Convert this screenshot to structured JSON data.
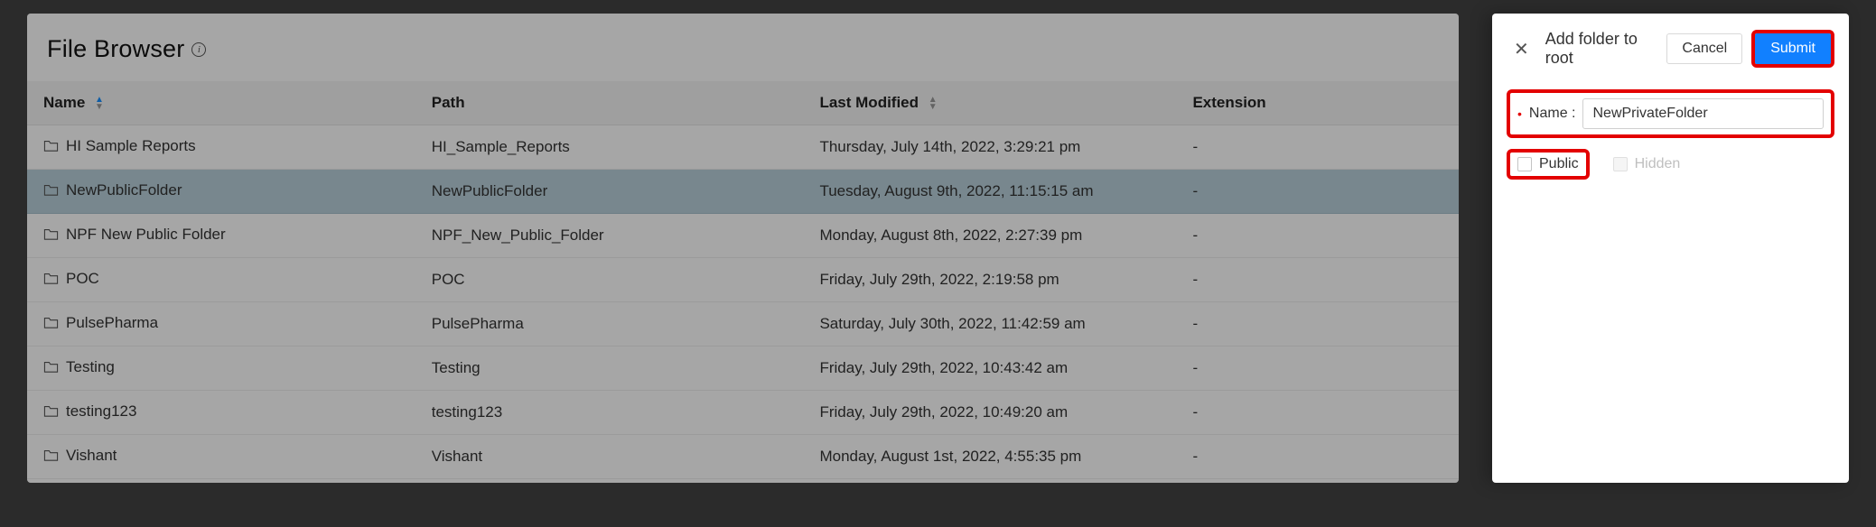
{
  "page": {
    "title": "File Browser"
  },
  "table": {
    "headers": {
      "name": "Name",
      "path": "Path",
      "last_modified": "Last Modified",
      "extension": "Extension"
    },
    "rows": [
      {
        "name": "HI Sample Reports",
        "path": "HI_Sample_Reports",
        "last_modified": "Thursday, July 14th, 2022, 3:29:21 pm",
        "extension": "-",
        "selected": false
      },
      {
        "name": "NewPublicFolder",
        "path": "NewPublicFolder",
        "last_modified": "Tuesday, August 9th, 2022, 11:15:15 am",
        "extension": "-",
        "selected": true
      },
      {
        "name": "NPF New Public Folder",
        "path": "NPF_New_Public_Folder",
        "last_modified": "Monday, August 8th, 2022, 2:27:39 pm",
        "extension": "-",
        "selected": false
      },
      {
        "name": "POC",
        "path": "POC",
        "last_modified": "Friday, July 29th, 2022, 2:19:58 pm",
        "extension": "-",
        "selected": false
      },
      {
        "name": "PulsePharma",
        "path": "PulsePharma",
        "last_modified": "Saturday, July 30th, 2022, 11:42:59 am",
        "extension": "-",
        "selected": false
      },
      {
        "name": "Testing",
        "path": "Testing",
        "last_modified": "Friday, July 29th, 2022, 10:43:42 am",
        "extension": "-",
        "selected": false
      },
      {
        "name": "testing123",
        "path": "testing123",
        "last_modified": "Friday, July 29th, 2022, 10:49:20 am",
        "extension": "-",
        "selected": false
      },
      {
        "name": "Vishant",
        "path": "Vishant",
        "last_modified": "Monday, August 1st, 2022, 4:55:35 pm",
        "extension": "-",
        "selected": false
      }
    ]
  },
  "panel": {
    "title": "Add folder to root",
    "cancel": "Cancel",
    "submit": "Submit",
    "name_label": "Name :",
    "name_value": "NewPrivateFolder",
    "public_label": "Public",
    "hidden_label": "Hidden",
    "public_checked": false,
    "hidden_checked": false,
    "hidden_disabled": true
  },
  "highlights": {
    "submit": true,
    "name_row": true,
    "public_group": true
  }
}
